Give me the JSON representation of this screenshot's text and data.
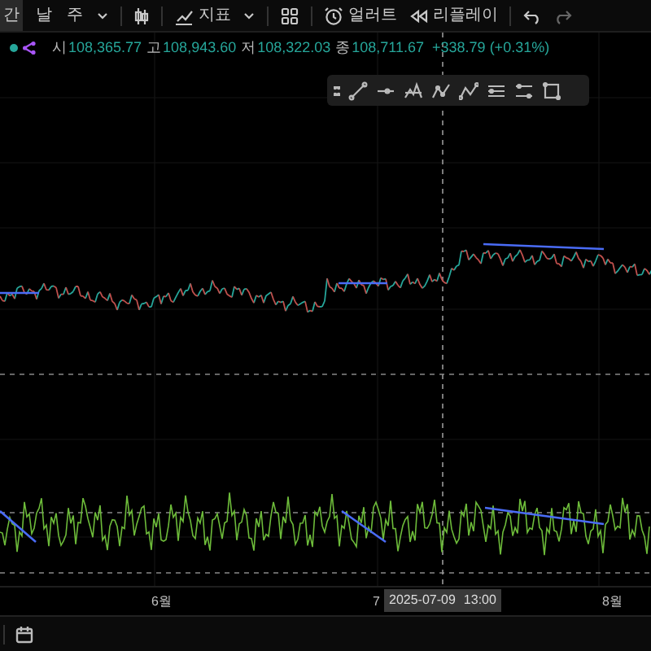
{
  "toolbar": {
    "items": [
      {
        "kind": "text",
        "label": "간"
      },
      {
        "kind": "text",
        "label": "날"
      },
      {
        "kind": "text",
        "label": "주"
      },
      {
        "kind": "caret"
      },
      {
        "kind": "candles"
      },
      {
        "kind": "indicator",
        "label": "지표"
      },
      {
        "kind": "caret"
      },
      {
        "kind": "grid"
      },
      {
        "kind": "alert",
        "label": "얼러트"
      },
      {
        "kind": "replay",
        "label": "리플레이"
      },
      {
        "kind": "undo"
      },
      {
        "kind": "redo"
      }
    ]
  },
  "legend": {
    "open_label": "시",
    "open": "108,365.77",
    "high_label": "고",
    "high": "108,943.60",
    "low_label": "저",
    "low": "108,322.03",
    "close_label": "종",
    "close": "108,711.67",
    "change": "+338.79 (+0.31%)"
  },
  "time_axis": {
    "labels": [
      "6월",
      "7",
      "8월"
    ],
    "crosshair_date": "2025-07-09",
    "crosshair_time": "13:00"
  }
}
